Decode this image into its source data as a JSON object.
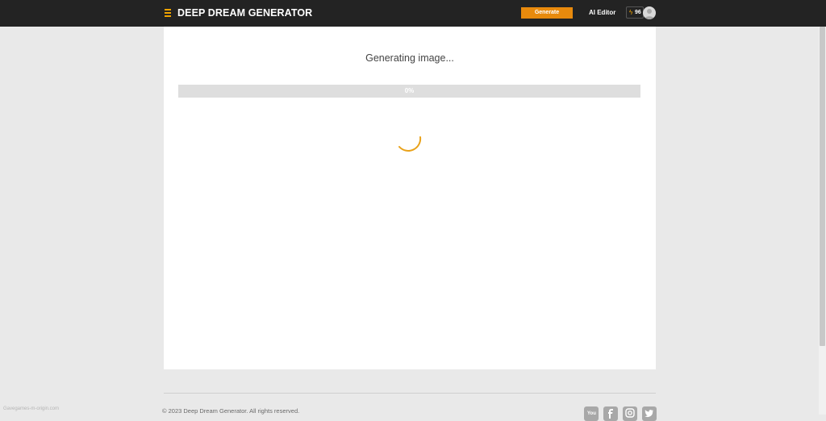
{
  "header": {
    "logo_text": "DEEP DREAM GENERATOR",
    "generate_label": "Generate",
    "ai_editor_label": "AI Editor",
    "energy_count": "96"
  },
  "main": {
    "status_text": "Generating image...",
    "progress_label": "0%",
    "progress_fraction": 0
  },
  "footer": {
    "copyright": "© 2023 Deep Dream Generator. All rights reserved.",
    "social_icons": [
      "youtube-icon",
      "facebook-icon",
      "instagram-icon",
      "twitter-icon"
    ]
  },
  "watermark": "Gavegames-m-origin.com",
  "colors": {
    "accent": "#e88a0d",
    "header_bg": "#232323",
    "page_bg": "#e9e9e9"
  }
}
